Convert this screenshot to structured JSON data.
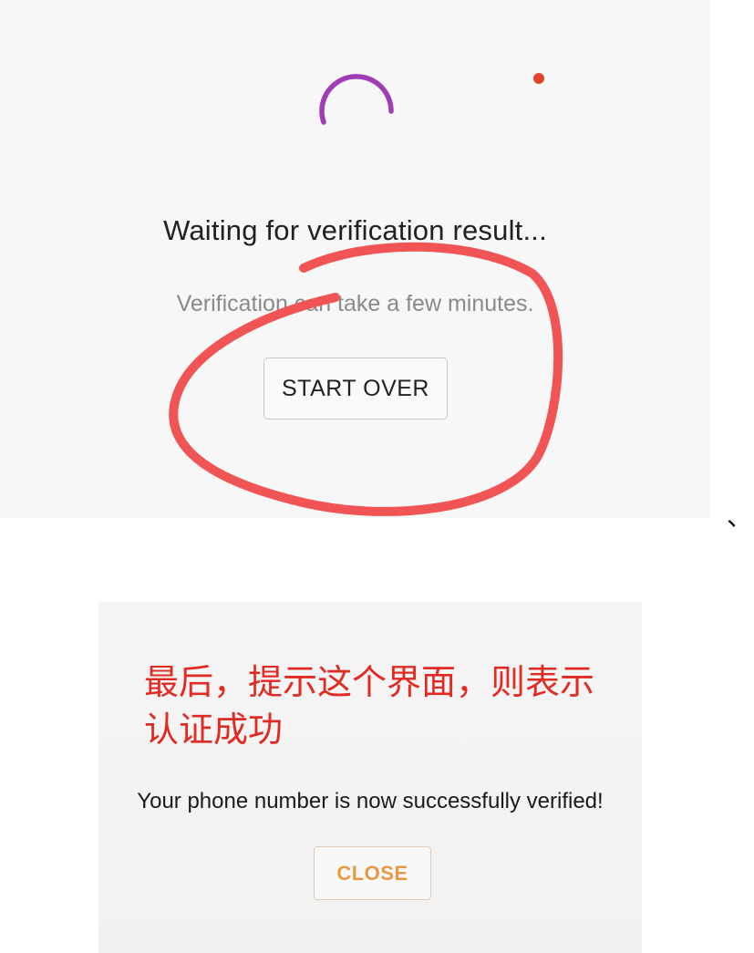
{
  "verification_screen": {
    "title": "Waiting for verification result...",
    "subtitle": "Verification can take a few minutes.",
    "start_over_label": "START OVER",
    "spinner_icon": "loading-spinner-icon",
    "spinner_color": "#a03cb4",
    "status_dot_color": "#e0442b"
  },
  "annotations": {
    "highlight_color": "#f05454",
    "separator": "、",
    "chinese_note": "最后，提示这个界面，则表示认证成功"
  },
  "success_screen": {
    "message": "Your phone number is now successfully verified!",
    "close_label": "CLOSE",
    "accent_color": "#e79a45"
  }
}
